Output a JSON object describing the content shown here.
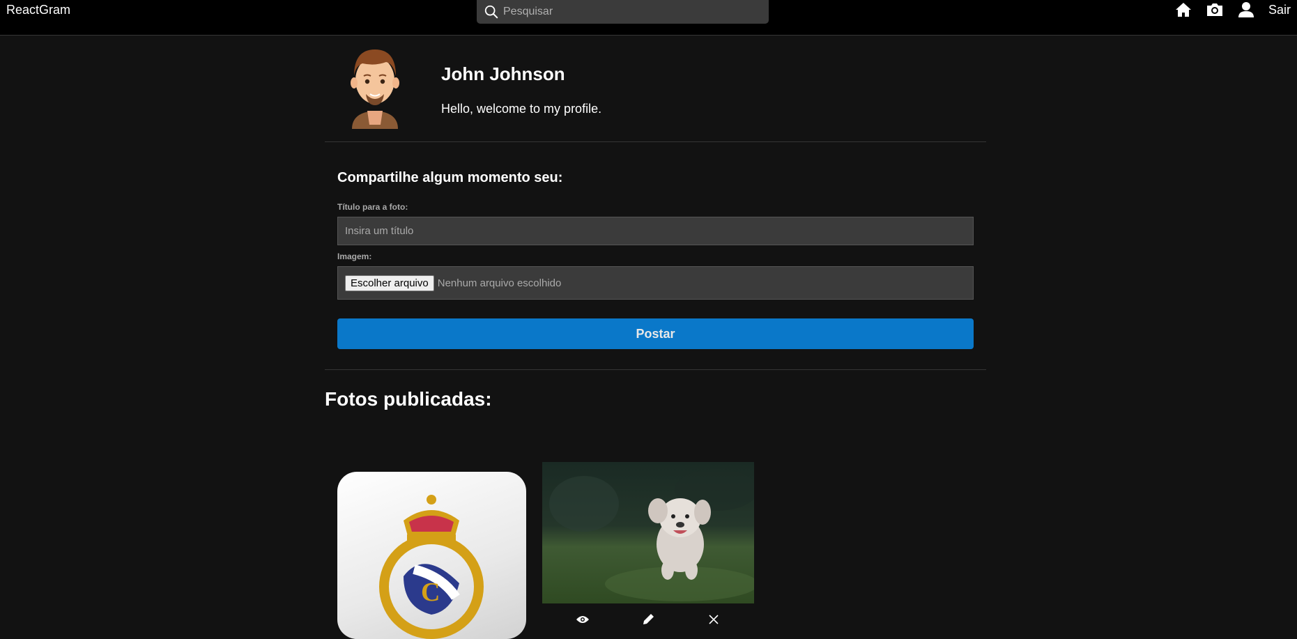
{
  "navbar": {
    "brand": "ReactGram",
    "search_placeholder": "Pesquisar",
    "icons": [
      "home-icon",
      "camera-icon",
      "user-icon"
    ],
    "logout_label": "Sair"
  },
  "profile": {
    "name": "John Johnson",
    "bio": "Hello, welcome to my profile."
  },
  "new_photo": {
    "heading": "Compartilhe algum momento seu:",
    "title_label": "Título para a foto:",
    "title_placeholder": "Insira um título",
    "image_label": "Imagem:",
    "file_button": "Escolher arquivo",
    "file_status": "Nenhum arquivo escolhido",
    "submit_label": "Postar"
  },
  "photos": {
    "heading": "Fotos publicadas:",
    "actions": [
      "eye-icon",
      "pencil-icon",
      "close-icon"
    ]
  },
  "colors": {
    "background": "#121212",
    "navbar": "#000000",
    "input": "#3b3b3b",
    "accent": "#0a78c9"
  }
}
